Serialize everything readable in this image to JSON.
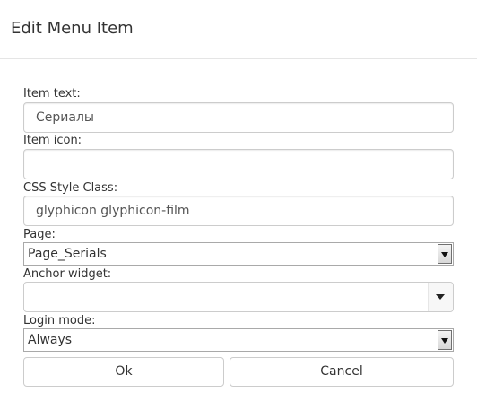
{
  "dialog": {
    "title": "Edit Menu Item"
  },
  "form": {
    "item_text": {
      "label": "Item text:",
      "value": "Сериалы"
    },
    "item_icon": {
      "label": "Item icon:",
      "value": ""
    },
    "css_style_class": {
      "label": "CSS Style Class:",
      "value": "glyphicon glyphicon-film"
    },
    "page": {
      "label": "Page:",
      "selected": "Page_Serials"
    },
    "anchor_widget": {
      "label": "Anchor widget:",
      "selected": ""
    },
    "login_mode": {
      "label": "Login mode:",
      "selected": "Always"
    }
  },
  "buttons": {
    "ok_label": "Ok",
    "cancel_label": "Cancel"
  },
  "icons": {
    "dropdown": "chevron-down-icon"
  }
}
